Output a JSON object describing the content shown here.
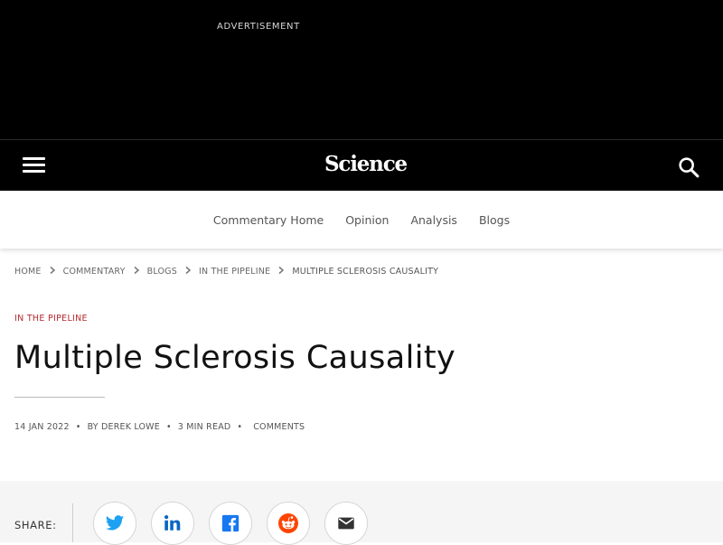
{
  "ad": {
    "label": "ADVERTISEMENT"
  },
  "header": {
    "logo": "Science",
    "menu_icon": "menu-icon",
    "search_icon": "search-icon"
  },
  "subnav": {
    "items": [
      "Commentary Home",
      "Opinion",
      "Analysis",
      "Blogs"
    ]
  },
  "breadcrumb": {
    "items": [
      "HOME",
      "COMMENTARY",
      "BLOGS",
      "IN THE PIPELINE"
    ],
    "current": "MULTIPLE SCLEROSIS CAUSALITY"
  },
  "article": {
    "kicker": "IN THE PIPELINE",
    "title": "Multiple Sclerosis Causality",
    "date": "14 JAN 2022",
    "author": "BY DEREK LOWE",
    "read_time": "3 MIN READ",
    "comments": "COMMENTS",
    "separator": "•"
  },
  "share": {
    "label": "SHARE:",
    "buttons": [
      "twitter-icon",
      "linkedin-icon",
      "facebook-icon",
      "reddit-icon",
      "email-icon"
    ]
  },
  "colors": {
    "kicker": "#b5292e",
    "twitter": "#1da1f2",
    "linkedin": "#0a66c2",
    "facebook": "#1877f2",
    "reddit": "#ff4500",
    "email": "#333333"
  }
}
